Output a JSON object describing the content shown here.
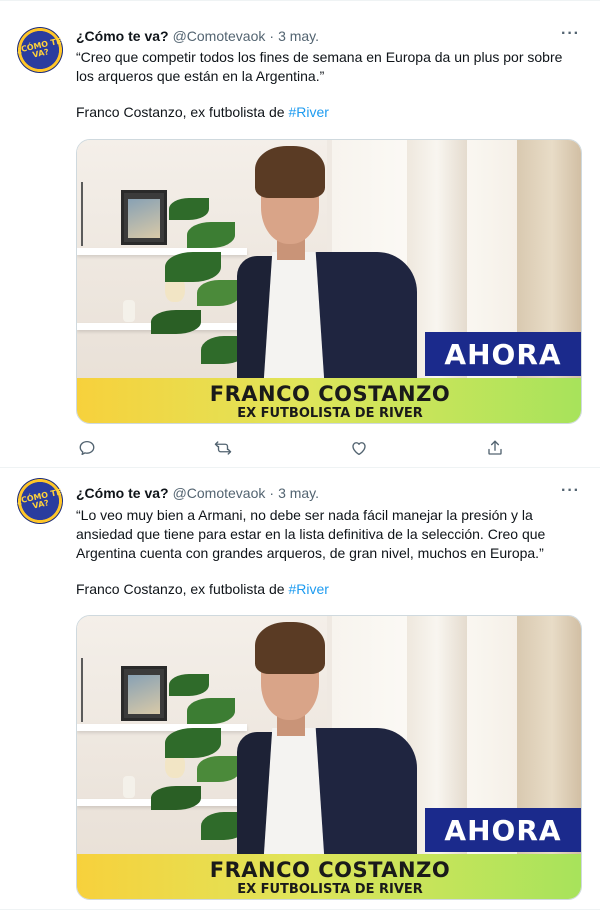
{
  "tweets": [
    {
      "author": {
        "name": "¿Cómo te va?",
        "handle": "@Comotevaok",
        "avatar_text": "¿CÓMO TE VA?"
      },
      "separator": "·",
      "date": "3 may.",
      "more": "···",
      "quote": "“Creo que competir todos los fines de semana en Europa da un plus por sobre los arqueros que están en la Argentina.”",
      "credit": "Franco Costanzo, ex futbolista de",
      "hashtag": "#River",
      "media": {
        "badge": "AHORA",
        "lower_third_name": "FRANCO COSTANZO",
        "lower_third_sub": "EX FUTBOLISTA DE RIVER"
      },
      "actions": [
        "reply-icon",
        "retweet-icon",
        "like-icon",
        "share-icon"
      ]
    },
    {
      "author": {
        "name": "¿Cómo te va?",
        "handle": "@Comotevaok",
        "avatar_text": "¿CÓMO TE VA?"
      },
      "separator": "·",
      "date": "3 may.",
      "more": "···",
      "quote": "“Lo veo muy bien a Armani, no debe ser nada fácil manejar la presión y la ansiedad que tiene para estar en la lista definitiva de la selección. Creo que Argentina cuenta con grandes arqueros, de gran nivel, muchos en Europa.”",
      "credit": "Franco Costanzo, ex futbolista de",
      "hashtag": "#River",
      "media": {
        "badge": "AHORA",
        "lower_third_name": "FRANCO COSTANZO",
        "lower_third_sub": "EX FUTBOLISTA DE RIVER"
      }
    }
  ],
  "colors": {
    "link": "#1d9bf0",
    "secondary_text": "#536471",
    "badge_bg": "#1b2a8c",
    "lower_third_start": "#f7d13c",
    "lower_third_end": "#a7e35b"
  }
}
